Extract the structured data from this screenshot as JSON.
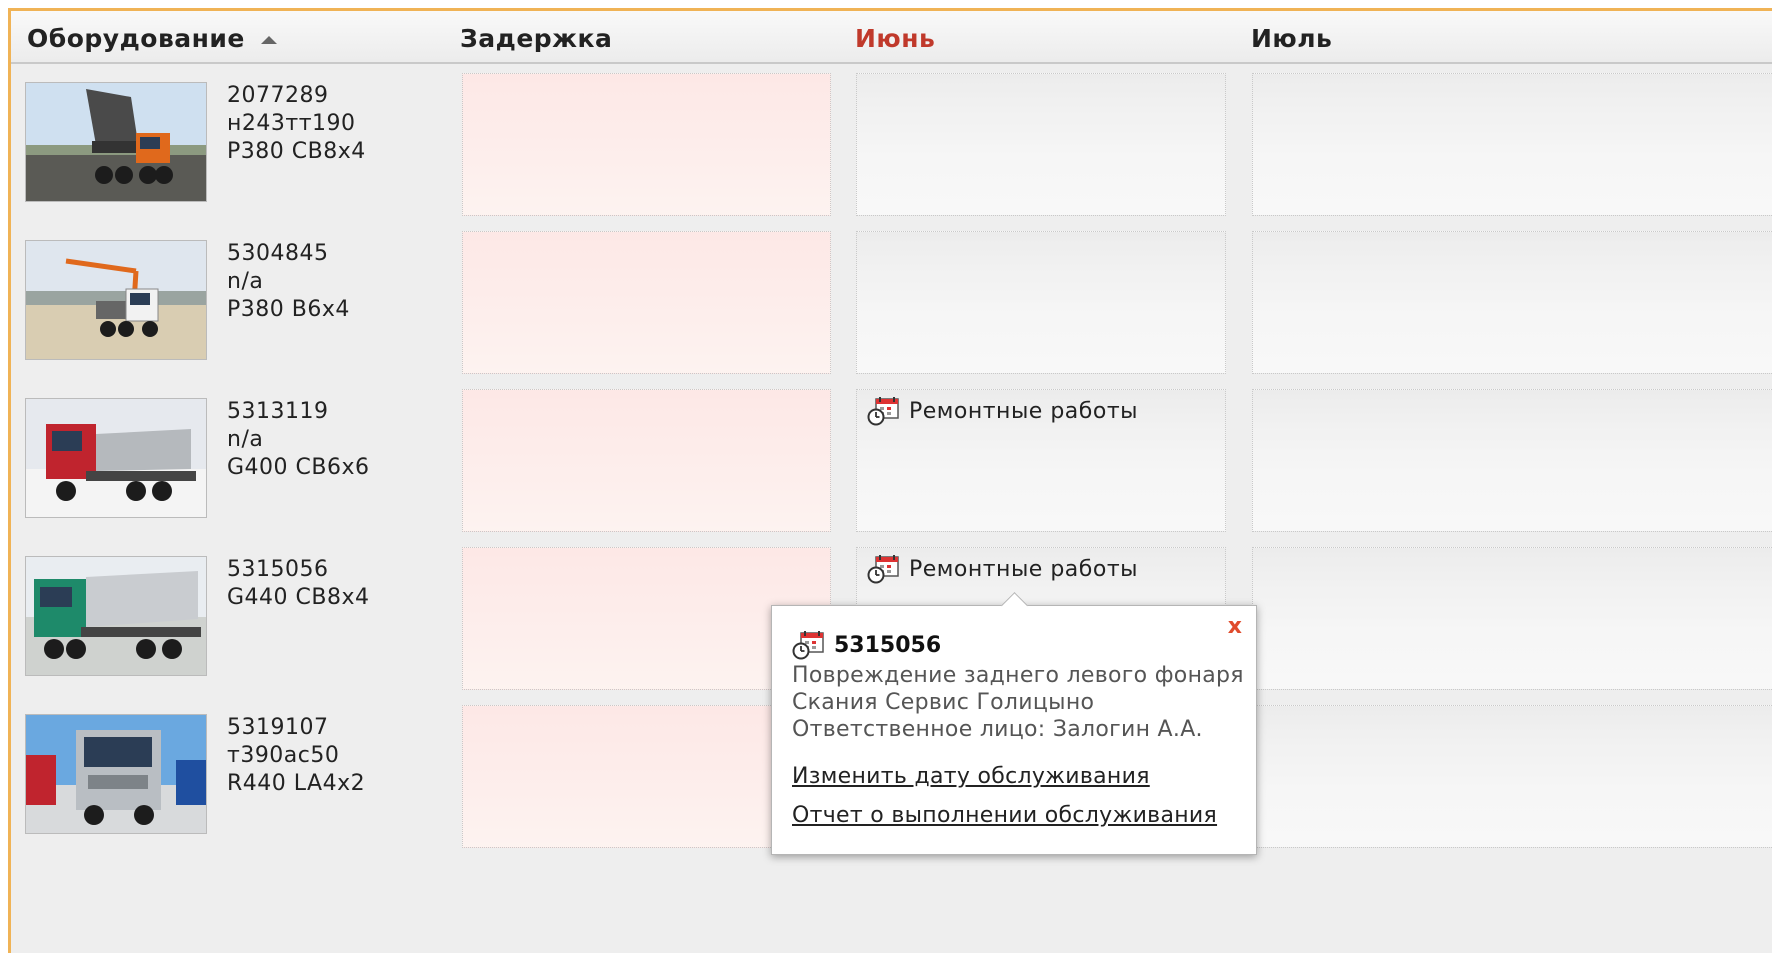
{
  "header": {
    "equipment": "Оборудование",
    "delay": "Задержка",
    "june": "Июнь",
    "july": "Июль"
  },
  "colors": {
    "accent_border": "#f0b356",
    "june_header": "#c0392b",
    "close": "#e04b2c"
  },
  "rows": [
    {
      "id": "2077289",
      "line2": "н243тт190",
      "line3": "P380 CB8x4",
      "image": "dump-truck-orange-photo"
    },
    {
      "id": "5304845",
      "line2": "n/a",
      "line3": "P380 B6x4",
      "image": "crane-truck-white-photo"
    },
    {
      "id": "5313119",
      "line2": "n/a",
      "line3": "G400 CB6x6",
      "image": "dump-truck-red-photo",
      "june_event": "Ремонтные работы"
    },
    {
      "id": "5315056",
      "line2": "G440 CB8x4",
      "line3": "",
      "image": "dump-truck-green-photo",
      "june_event": "Ремонтные работы"
    },
    {
      "id": "5319107",
      "line2": "т390ас50",
      "line3": "R440 LA4x2",
      "image": "tractor-unit-silver-photo"
    }
  ],
  "popup": {
    "title": "5315056",
    "description": "Повреждение заднего левого фонаря",
    "service": "Скания Сервис Голицыно",
    "responsible": "Ответственное лицо: Залогин А.А.",
    "close": "x",
    "link_change_date": "Изменить дату обслуживания",
    "link_report": "Отчет о выполнении обслуживания"
  }
}
